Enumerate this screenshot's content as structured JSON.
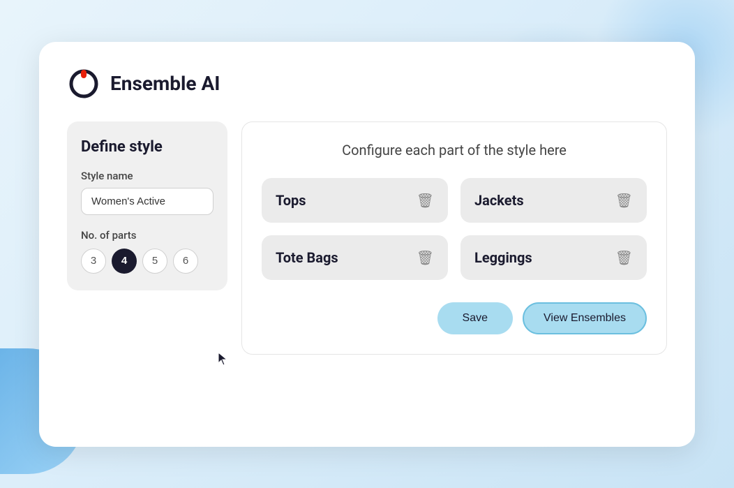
{
  "app": {
    "title": "Ensemble AI"
  },
  "left_panel": {
    "title": "Define style",
    "style_name_label": "Style name",
    "style_name_value": "Women's Active",
    "parts_label": "No. of parts",
    "parts_options": [
      {
        "value": "3",
        "active": false
      },
      {
        "value": "4",
        "active": true
      },
      {
        "value": "5",
        "active": false
      },
      {
        "value": "6",
        "active": false
      }
    ]
  },
  "right_panel": {
    "configure_title": "Configure each part of the style here",
    "parts": [
      {
        "name": "Tops"
      },
      {
        "name": "Jackets"
      },
      {
        "name": "Tote Bags"
      },
      {
        "name": "Leggings"
      }
    ],
    "save_label": "Save",
    "view_ensembles_label": "View Ensembles"
  },
  "icons": {
    "trash": "🗑",
    "logo_ring": "⏻"
  }
}
